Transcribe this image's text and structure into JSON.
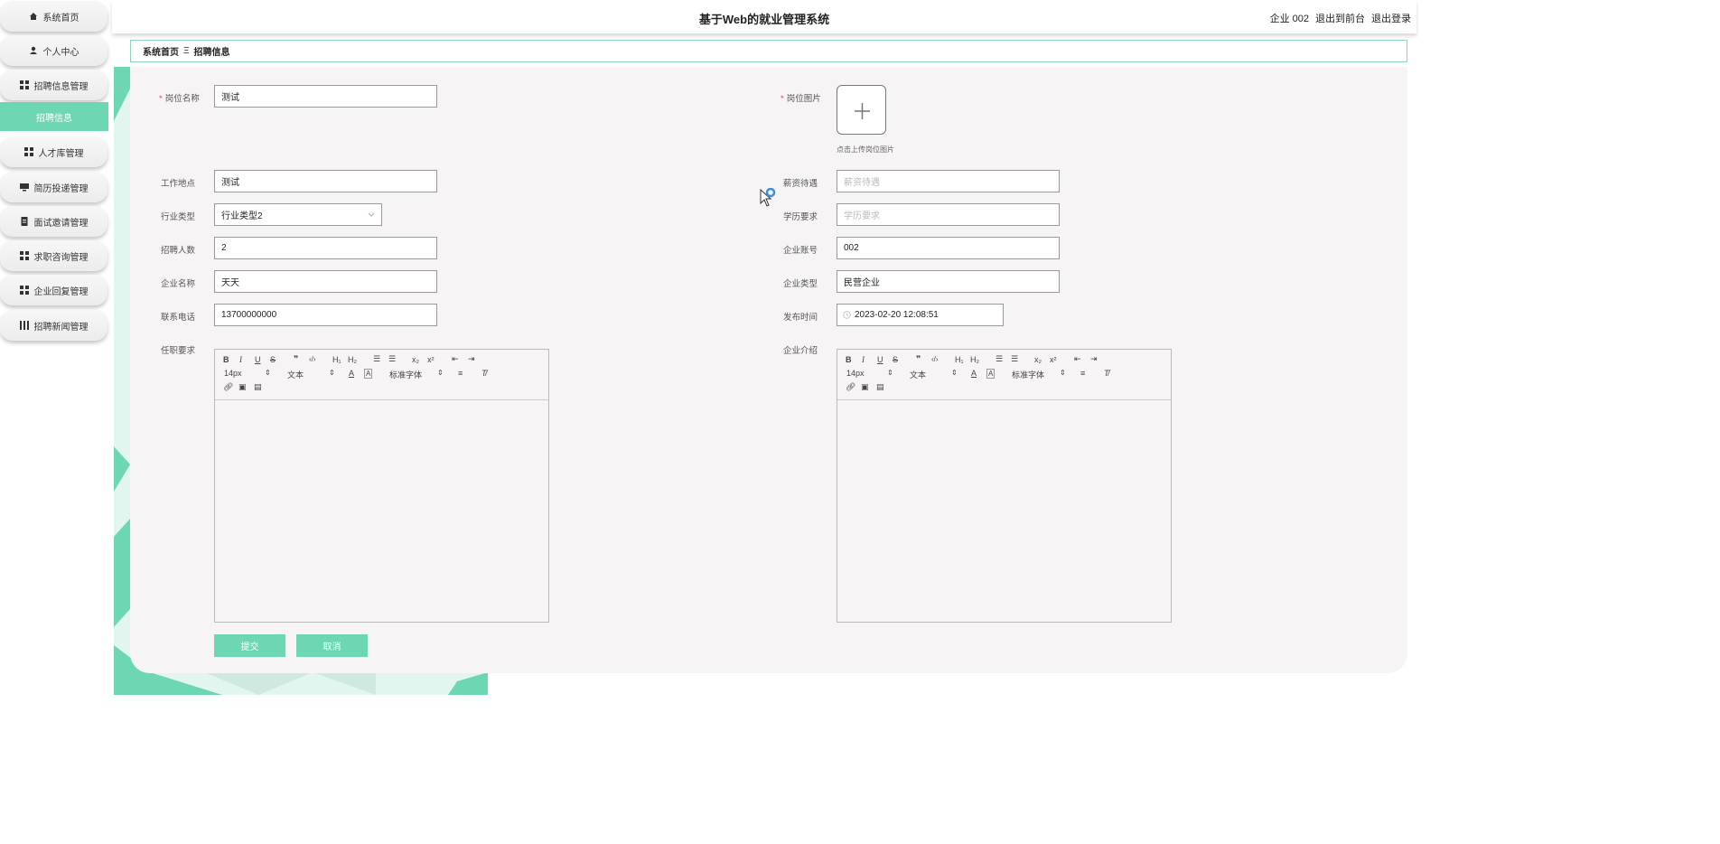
{
  "sidebar": {
    "items": [
      {
        "label": "系统首页",
        "icon": "home-icon"
      },
      {
        "label": "个人中心",
        "icon": "user-icon"
      },
      {
        "label": "招聘信息管理",
        "icon": "grid-icon"
      },
      {
        "label": "招聘信息",
        "icon": ""
      },
      {
        "label": "人才库管理",
        "icon": "grid-icon"
      },
      {
        "label": "简历投递管理",
        "icon": "monitor-icon"
      },
      {
        "label": "面试邀请管理",
        "icon": "document-icon"
      },
      {
        "label": "求职咨询管理",
        "icon": "grid-icon"
      },
      {
        "label": "企业回复管理",
        "icon": "grid-icon"
      },
      {
        "label": "招聘新闻管理",
        "icon": "bar-chart-icon"
      }
    ]
  },
  "header": {
    "title": "基于Web的就业管理系统",
    "user": "企业 002",
    "to_front": "退出到前台",
    "logout": "退出登录"
  },
  "breadcrumb": {
    "home": "系统首页",
    "sep": "Ξ",
    "current": "招聘信息"
  },
  "form": {
    "job_name": {
      "label": "岗位名称",
      "value": "测试"
    },
    "job_image": {
      "label": "岗位图片",
      "hint": "点击上传岗位图片"
    },
    "location": {
      "label": "工作地点",
      "value": "测试"
    },
    "salary": {
      "label": "薪资待遇",
      "placeholder": "薪资待遇"
    },
    "industry": {
      "label": "行业类型",
      "value": "行业类型2"
    },
    "education": {
      "label": "学历要求",
      "placeholder": "学历要求"
    },
    "headcount": {
      "label": "招聘人数",
      "value": "2"
    },
    "company_account": {
      "label": "企业账号",
      "value": "002"
    },
    "company_name": {
      "label": "企业名称",
      "value": "天天"
    },
    "company_type": {
      "label": "企业类型",
      "value": "民营企业"
    },
    "phone": {
      "label": "联系电话",
      "value": "13700000000"
    },
    "publish_time": {
      "label": "发布时间",
      "value": "2023-02-20 12:08:51"
    },
    "requirements": {
      "label": "任职要求"
    },
    "company_intro": {
      "label": "企业介绍"
    },
    "editor_toolbar": {
      "font_size": "14px",
      "format": "文本",
      "font": "标准字体"
    },
    "submit_label": "提交",
    "cancel_label": "取消"
  },
  "colors": {
    "accent": "#6dd6b3",
    "required": "#e44444"
  }
}
